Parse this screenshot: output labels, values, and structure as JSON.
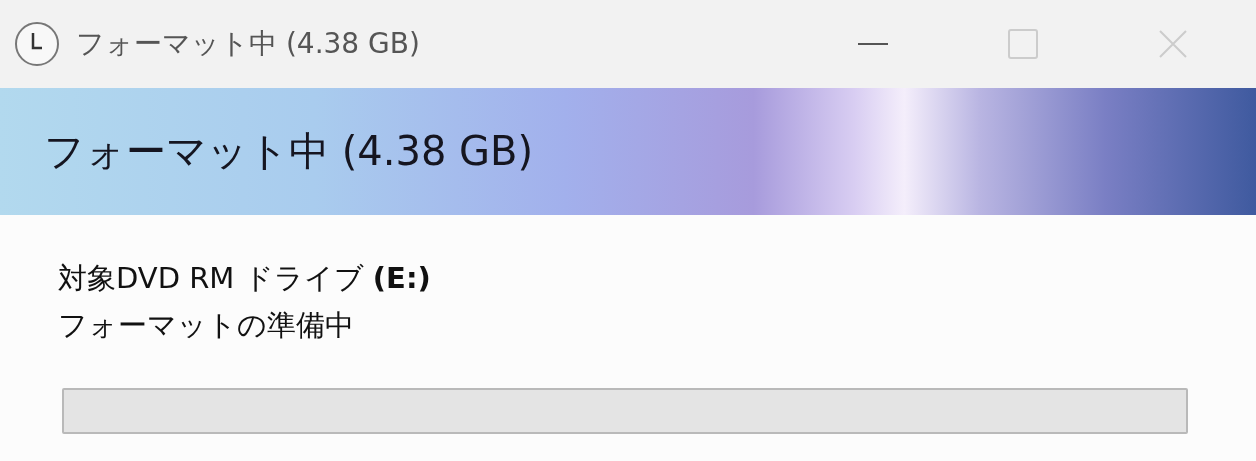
{
  "window": {
    "title": "フォーマット中 (4.38 GB)"
  },
  "banner": {
    "title": "フォーマット中 (4.38 GB)"
  },
  "details": [
    "対象DVD RM ドライブ **(E:)**",
    "フォーマットの準備中"
  ],
  "progress": {
    "level": 0
  }
}
